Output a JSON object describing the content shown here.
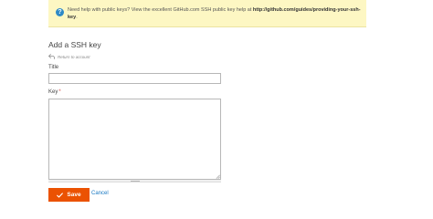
{
  "notice": {
    "icon": "question-icon",
    "text": "Need help with public keys? View the excellent GitHub.com SSH public key help at ",
    "link_text": "http://github.com/guides/providing-your-ssh-key",
    "suffix": "."
  },
  "page": {
    "title": "Add a SSH key"
  },
  "return_link": {
    "icon": "return-arrow-icon",
    "label": "Return to account"
  },
  "form": {
    "title_label": "Title",
    "title_value": "",
    "key_label": "Key",
    "key_required_mark": "*",
    "key_value": ""
  },
  "actions": {
    "save_label": "Save",
    "save_icon": "check-icon",
    "cancel_label": "Cancel"
  },
  "colors": {
    "notice_background": "#fdf7c3",
    "notice_icon": "#2f8ac6",
    "save_button": "#eb5202",
    "link": "#1979c3"
  }
}
